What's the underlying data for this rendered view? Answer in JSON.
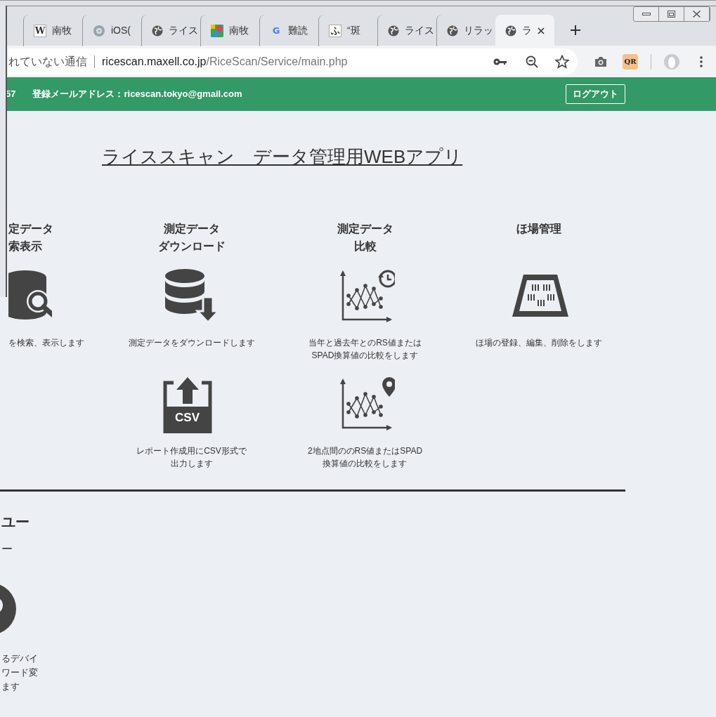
{
  "browser": {
    "tabs": [
      {
        "kind": "letter",
        "icon_text": "W",
        "label": "南牧",
        "selected": false
      },
      {
        "kind": "flower",
        "label": "iOS(",
        "selected": false
      },
      {
        "kind": "globe",
        "label": "ライス",
        "selected": false
      },
      {
        "kind": "map",
        "label": "南牧",
        "selected": false
      },
      {
        "kind": "google",
        "icon_text": "G",
        "label": "難読",
        "selected": false
      },
      {
        "kind": "letter",
        "icon_text": "ふ",
        "label": "“斑",
        "selected": false
      },
      {
        "kind": "globe",
        "label": "ライス",
        "selected": false
      },
      {
        "kind": "globe",
        "label": "リラッ",
        "selected": false
      },
      {
        "kind": "globe",
        "label": "ラ",
        "selected": true
      }
    ],
    "address": {
      "security": "れていない通信",
      "host": "ricescan.maxell.co.jp",
      "path": "/RiceScan/Service/main.php"
    },
    "extension_text": "QR"
  },
  "header": {
    "user_id": "57",
    "email": "登録メールアドレス：ricescan.tokyo@gmail.com",
    "logout": "ログアウト"
  },
  "title": "ライススキャン　データ管理用WEBアプリ",
  "feature_columns": [
    [
      {
        "kind": "search-db",
        "title": [
          "定データ",
          "索表示"
        ],
        "description": [
          "を検索、表示します"
        ]
      }
    ],
    [
      {
        "kind": "db-download",
        "title": [
          "測定データ",
          "ダウンロード"
        ],
        "description": [
          "測定データをダウンロードします"
        ]
      },
      {
        "kind": "csv",
        "icon_text": "CSV",
        "description": [
          "レポート作成用にCSV形式で",
          "出力します"
        ]
      }
    ],
    [
      {
        "kind": "chart-history",
        "title": [
          "測定データ",
          "比較"
        ],
        "description": [
          "当年と過去年とのRS値または",
          "SPAD換算値の比較をします"
        ]
      },
      {
        "kind": "chart-pin",
        "description": [
          "2地点間ののRS値またはSPAD",
          "換算値の比較をします"
        ]
      }
    ],
    [
      {
        "kind": "field",
        "title": [
          "ほ場管理"
        ],
        "description": [
          "ほ場の登録、編集、削除をします"
        ]
      }
    ]
  ],
  "menu": {
    "heading": "ユー",
    "subheading": "ー",
    "description": [
      "るデバイ",
      "ワード変",
      "ます"
    ]
  }
}
